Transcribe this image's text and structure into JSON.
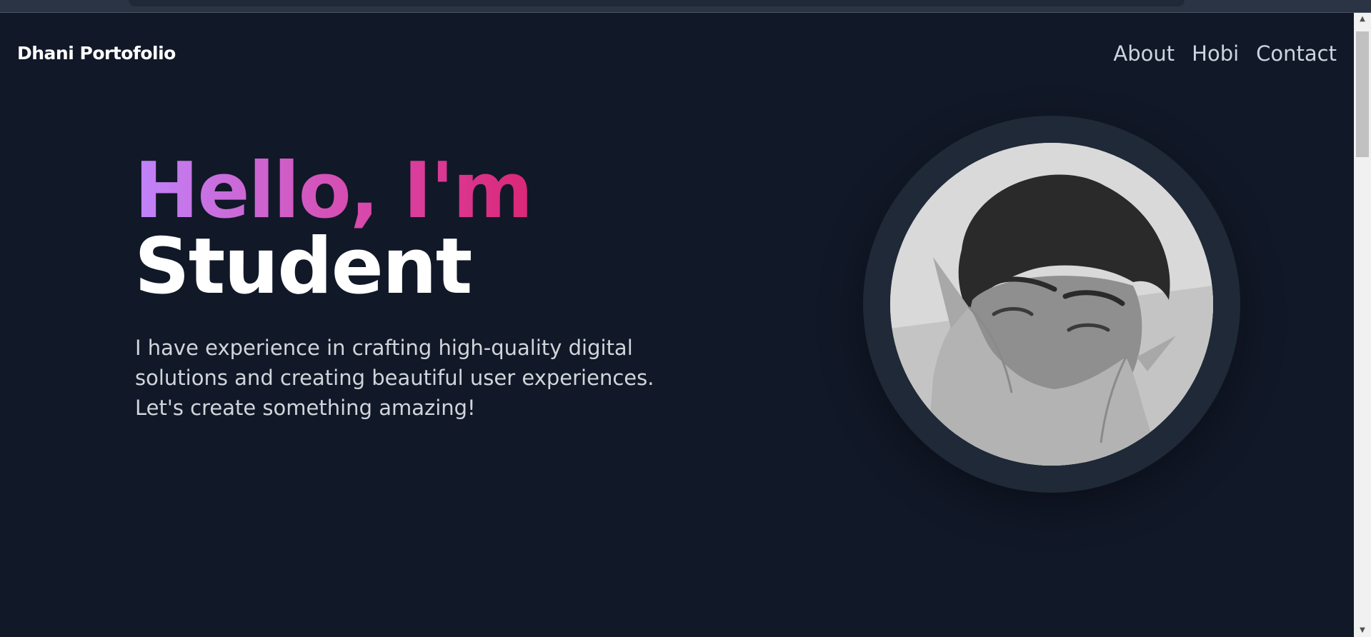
{
  "header": {
    "brand": "Dhani Portofolio",
    "nav": [
      {
        "label": "About"
      },
      {
        "label": "Hobi"
      },
      {
        "label": "Contact"
      }
    ]
  },
  "hero": {
    "greeting": "Hello, I'm",
    "role": "Student",
    "description": "I have experience in crafting high-quality digital solutions and creating beautiful user experiences. Let's create something amazing!"
  },
  "colors": {
    "background": "#111827",
    "gradient_start": "#c084fc",
    "gradient_end": "#db2777",
    "avatar_ring": "#1f2937"
  }
}
